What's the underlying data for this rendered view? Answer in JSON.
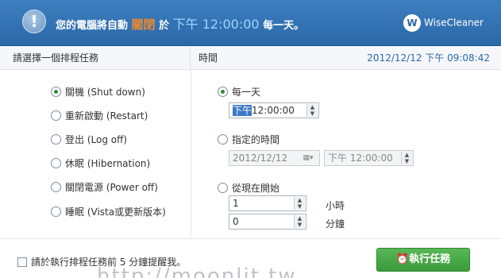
{
  "header": {
    "alert_glyph": "!",
    "prefix": "您的電腦將自動",
    "action": "關閉",
    "at": "於",
    "time": "下午 12:00:00",
    "suffix": "每一天。",
    "brand_logo": "W",
    "brand": "WiseCleaner"
  },
  "columns": {
    "task_header": "請選擇一個排程任務",
    "time_header": "時間",
    "current_datetime": "2012/12/12 下午 09:08:42"
  },
  "tasks": [
    {
      "label": "關機 (Shut down)",
      "selected": true
    },
    {
      "label": "重新啟動 (Restart)",
      "selected": false
    },
    {
      "label": "登出 (Log off)",
      "selected": false
    },
    {
      "label": "休眠 (Hibernation)",
      "selected": false
    },
    {
      "label": "關閉電源 (Power off)",
      "selected": false
    },
    {
      "label": "睡眠 (Vista或更新版本)",
      "selected": false
    }
  ],
  "schedule": {
    "daily": {
      "label": "每一天",
      "selected": true,
      "ampm": "下午",
      "time": "12:00:00"
    },
    "specific": {
      "label": "指定的時間",
      "selected": false,
      "date": "2012/12/12",
      "time": "下午 12:00:00"
    },
    "from_now": {
      "label": "從現在開始",
      "selected": false,
      "hours": "1",
      "hours_unit": "小時",
      "minutes": "0",
      "minutes_unit": "分鐘"
    }
  },
  "footer": {
    "remind_label": "請於執行排程任務前 5 分鐘提醒我。",
    "run_icon": "alarm-clock-icon",
    "run_label": "執行任務",
    "watermark": "http://moonlit.tw"
  }
}
